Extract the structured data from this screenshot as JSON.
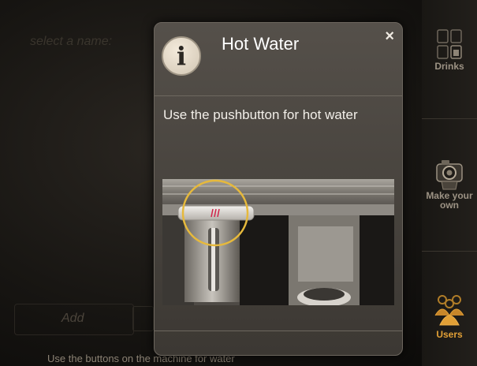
{
  "background": {
    "name_prompt": "select a name:",
    "add_label": "Add",
    "footer_text": "Use the buttons on the machine for water"
  },
  "sidebar": {
    "items": [
      {
        "label": "Drinks",
        "icon": "drinks-grid-icon",
        "active": false
      },
      {
        "label": "Make your own",
        "icon": "camera-cup-icon",
        "active": false
      },
      {
        "label": "Users",
        "icon": "users-icon",
        "active": true
      }
    ]
  },
  "dialog": {
    "title": "Hot Water",
    "message": "Use the pushbutton for hot  water",
    "close_symbol": "×",
    "info_symbol": "i",
    "image": "hot-water-pushbutton-illustration"
  },
  "colors": {
    "accent": "#e2a036",
    "highlight_ring": "#e6b93c",
    "button_marks": "#d2234a"
  }
}
